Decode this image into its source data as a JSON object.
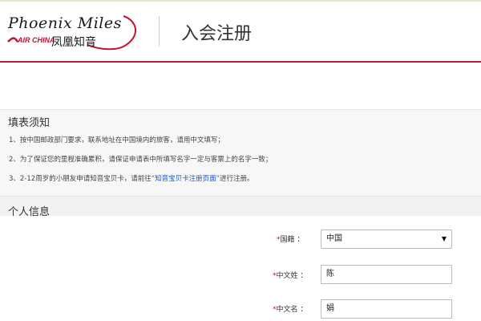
{
  "header": {
    "logo": {
      "script_text": "Phoenix Miles",
      "airline_text": "AIR CHINA",
      "cn_text": "凤凰知音"
    },
    "title": "入会注册"
  },
  "notice": {
    "title": "填表须知",
    "items": [
      {
        "text": "1、按中国邮政部门要求，联系地址在中国境内的旅客，请用中文填写；"
      },
      {
        "text": "2、为了保证您的里程准确累积，请保证申请表中所填写名字一定与客票上的名字一致；"
      },
      {
        "before": "3、2-12周岁的小朋友申请知音宝贝卡，请前往",
        "link": "“知音宝贝卡注册页面”",
        "after": "进行注册。"
      }
    ]
  },
  "personal": {
    "title": "个人信息",
    "fields": {
      "nationality": {
        "label": "国籍",
        "colon": "：",
        "value": "中国",
        "required_mark": "*"
      },
      "surname_cn": {
        "label": "中文姓",
        "colon": "：",
        "value": "陈",
        "required_mark": "*"
      },
      "given_name_cn": {
        "label": "中文名",
        "colon": "：",
        "value": "娟",
        "required_mark": "*"
      }
    }
  },
  "colors": {
    "brand_red": "#b2232f",
    "link_blue": "#1f57c3",
    "required_red": "#c8102e"
  },
  "icons": {
    "select_arrow": "▼"
  }
}
